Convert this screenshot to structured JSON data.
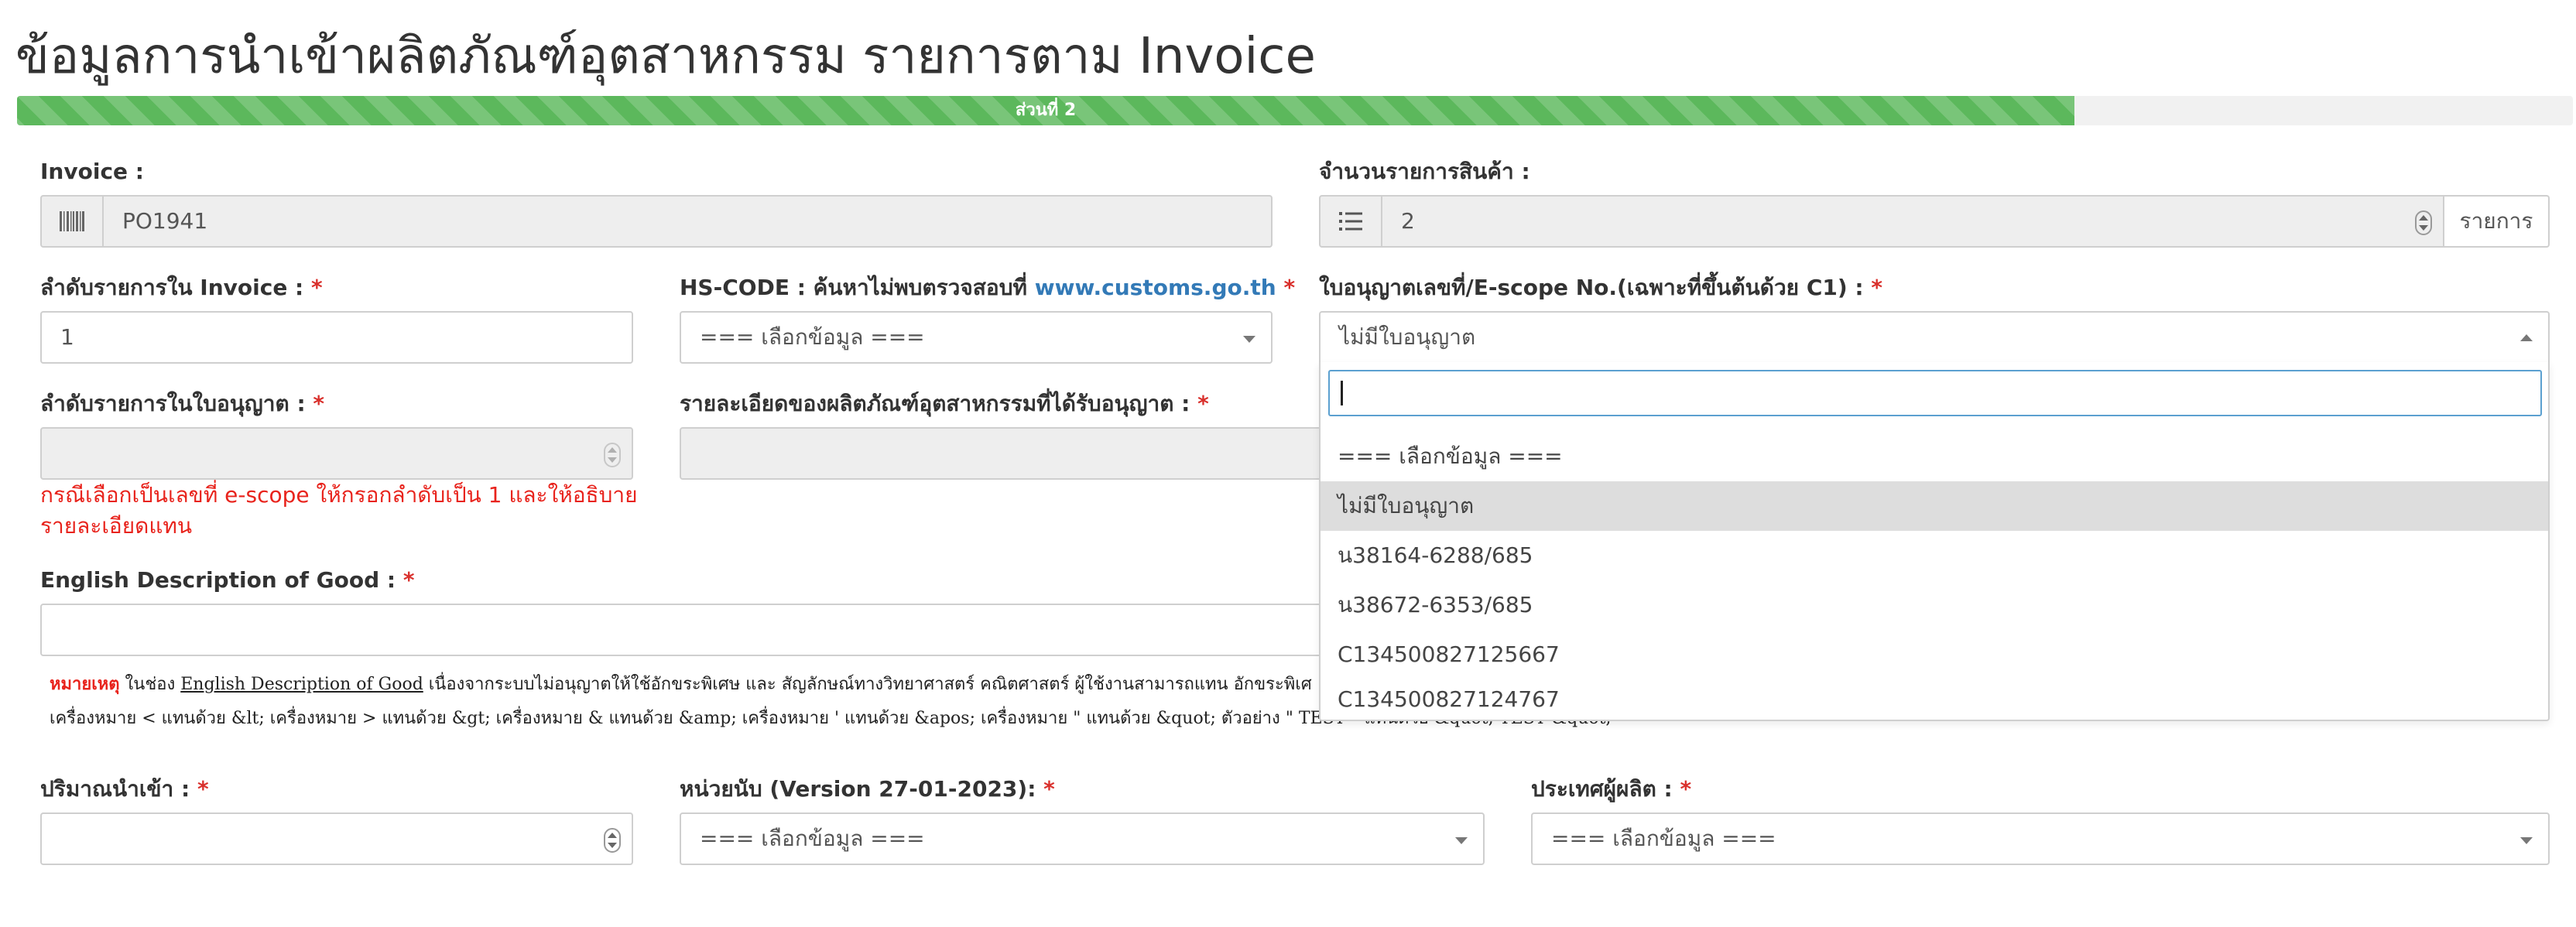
{
  "page": {
    "title": "ข้อมูลการนำเข้าผลิตภัณฑ์อุตสาหกรรม รายการตาม Invoice",
    "progress_label": "ส่วนที่ 2",
    "progress_value": 0.805
  },
  "invoice": {
    "label": "Invoice :",
    "value": "PO1941",
    "icon": "barcode-icon"
  },
  "item_count": {
    "label": "จำนวนรายการสินค้า :",
    "value": "2",
    "unit": "รายการ",
    "icon": "list-icon"
  },
  "invoice_seq": {
    "label": "ลำดับรายการใน Invoice :",
    "required": "*",
    "value": "1"
  },
  "hs_code": {
    "label": "HS-CODE : ค้นหาไม่พบตรวจสอบที่",
    "link": "www.customs.go.th",
    "required": "*",
    "value": "=== เลือกข้อมูล ==="
  },
  "license": {
    "label": "ใบอนุญาตเลขที่/E-scope No.(เฉพาะที่ขึ้นต้นด้วย C1) :",
    "required": "*",
    "value": "ไม่มีใบอนุญาต",
    "search_placeholder": "",
    "options": [
      "=== เลือกข้อมูล ===",
      "ไม่มีใบอนุญาต",
      "น38164-6288/685",
      "น38672-6353/685",
      "C134500827125667",
      "C134500827124767"
    ],
    "selected_index": 1
  },
  "license_seq": {
    "label": "ลำดับรายการในใบอนุญาต :",
    "required": "*",
    "value": "",
    "help_line1": "กรณีเลือกเป็นเลขที่ e-scope ให้กรอกลำดับเป็น 1 และให้อธิบาย",
    "help_line2": "รายละเอียดแทน"
  },
  "product_detail": {
    "label": "รายละเอียดของผลิตภัณฑ์อุตสาหกรรมที่ได้รับอนุญาต :",
    "required": "*",
    "value": ""
  },
  "english_desc": {
    "label": "English Description of Good :",
    "required": "*",
    "value": "",
    "note_prefix": "หมายเหตุ",
    "note_part1": " ในช่อง ",
    "note_underline": "English Description of Good",
    "note_part2": " เนื่องจากระบบไม่อนุญาตให้ใช้อักขระพิเศษ และ สัญลักษณ์ทางวิทยาศาสตร์ คณิตศาสตร์ ผู้ใช้งานสามารถแทน อักขระพิเศ",
    "note_line2": "เครื่องหมาย < แทนด้วย &lt; เครื่องหมาย > แทนด้วย &gt; เครื่องหมาย & แทนด้วย &amp; เครื่องหมาย ' แทนด้วย &apos; เครื่องหมาย \" แทนด้วย &quot; ตัวอย่าง \" TEST \" แทนด้วย &quot; TEST &quot;"
  },
  "quantity": {
    "label": "ปริมาณนำเข้า :",
    "required": "*",
    "value": ""
  },
  "unit": {
    "label": "หน่วยนับ (Version 27-01-2023):",
    "required": "*",
    "value": "=== เลือกข้อมูล ==="
  },
  "country": {
    "label": "ประเทศผู้ผลิต :",
    "required": "*",
    "value": "=== เลือกข้อมูล ==="
  },
  "colors": {
    "progress": "#5cb85c",
    "required": "#d9302c",
    "link": "#337ab7",
    "focus": "#5ba0d0"
  }
}
